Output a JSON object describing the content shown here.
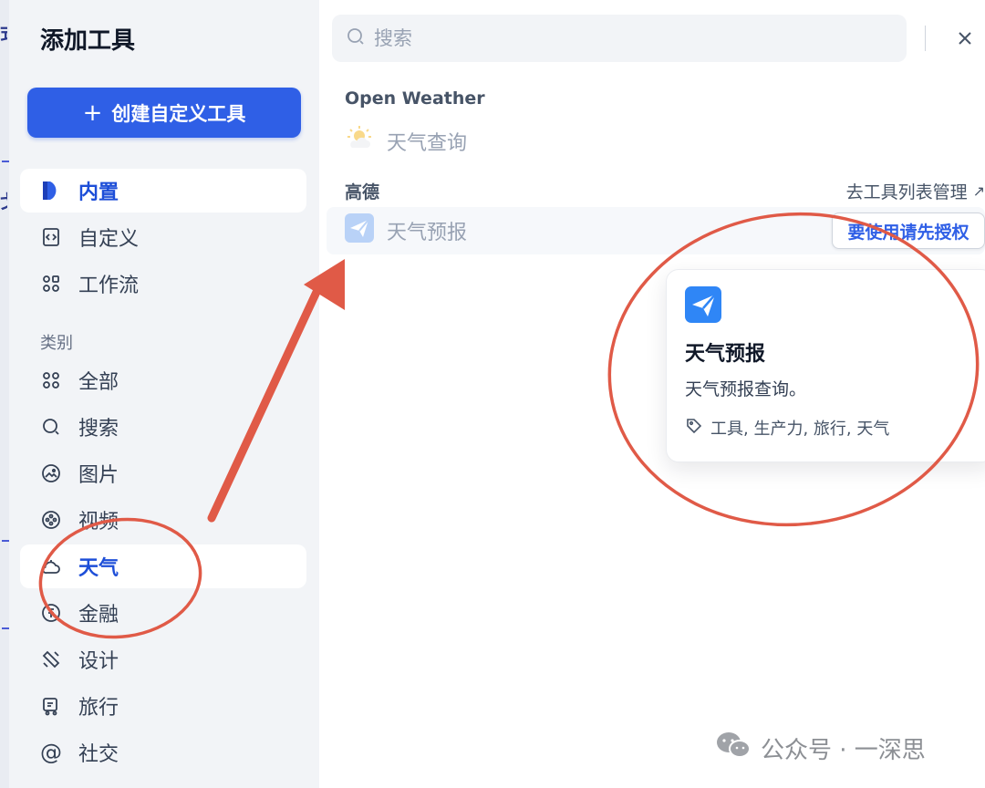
{
  "modal": {
    "title": "添加工具"
  },
  "sidebar": {
    "create_button": "创建自定义工具",
    "primary_items": [
      {
        "label": "内置",
        "icon": "builtin-icon",
        "active": true
      },
      {
        "label": "自定义",
        "icon": "custom-code-icon",
        "active": false
      },
      {
        "label": "工作流",
        "icon": "workflow-icon",
        "active": false
      }
    ],
    "category_label": "类别",
    "categories": [
      {
        "label": "全部",
        "icon": "grid-icon",
        "active": false
      },
      {
        "label": "搜索",
        "icon": "search-icon",
        "active": false
      },
      {
        "label": "图片",
        "icon": "image-icon",
        "active": false
      },
      {
        "label": "视频",
        "icon": "video-icon",
        "active": false
      },
      {
        "label": "天气",
        "icon": "weather-icon",
        "active": true
      },
      {
        "label": "金融",
        "icon": "finance-icon",
        "active": false
      },
      {
        "label": "设计",
        "icon": "design-icon",
        "active": false
      },
      {
        "label": "旅行",
        "icon": "travel-icon",
        "active": false
      },
      {
        "label": "社交",
        "icon": "social-icon",
        "active": false
      }
    ]
  },
  "main": {
    "search_placeholder": "搜索",
    "providers": [
      {
        "name": "Open Weather",
        "tools": [
          {
            "label": "天气查询",
            "icon": "sun-cloud-icon"
          }
        ]
      },
      {
        "name": "高德",
        "tools": [
          {
            "label": "天气预报",
            "icon": "paper-plane-icon"
          }
        ]
      }
    ],
    "manage_link": "去工具列表管理",
    "auth_button": "要使用请先授权",
    "tooltip": {
      "title": "天气预报",
      "description": "天气预报查询。",
      "tags": "工具, 生产力, 旅行, 天气"
    }
  },
  "watermark": {
    "text": "公众号 · 一深思"
  },
  "colors": {
    "accent": "#2f5fe6",
    "annotation": "#e05a47",
    "sidebar_bg": "#f2f4f7"
  }
}
